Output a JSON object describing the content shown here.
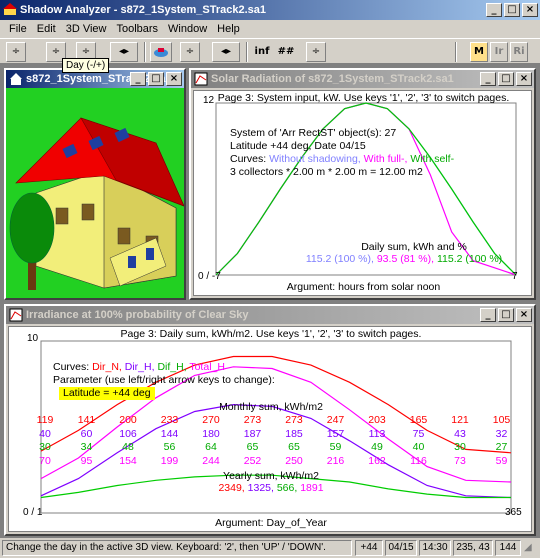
{
  "app": {
    "title": "Shadow Analyzer - s872_1System_STrack2.sa1"
  },
  "menu": [
    "File",
    "Edit",
    "3D View",
    "Toolbars",
    "Window",
    "Help"
  ],
  "toolbar": {
    "inf_label": "inf",
    "hash_label": "##",
    "m_label": "M",
    "ir_label": "Ir",
    "ri_label": "Ri"
  },
  "tooltip": "Day (-/+)",
  "view3d": {
    "title": "s872_1System_STrack2.sa1"
  },
  "solar": {
    "title": "Solar Radiation of s872_1System_STrack2.sa1",
    "header": "Page 3: System input, kW. Use keys '1', '2', '3' to switch pages.",
    "line1": "System of 'Arr RectST' object(s): 27",
    "line2": "Latitude +44 deg, Date 04/15",
    "curves_label": "Curves: ",
    "curve_without": "Without shadowing, ",
    "curve_full": "With full-, ",
    "curve_self": "With self-",
    "line4": "3 collectors * 2.00 m * 2.00 m = 12.00 m2",
    "daily_title": "Daily sum, kWh and %",
    "daily_a": "115.2 (100 %), ",
    "daily_b": "93.5 (81 %), ",
    "daily_c": "115.2 (100 %)",
    "y_top": "12",
    "x_left": "0 / -7",
    "x_right": "7",
    "xlabel": "Argument: hours from solar noon",
    "colors": {
      "without": "#8080ff",
      "full": "#ff00ff",
      "self": "#00cc00"
    },
    "chart_data": {
      "type": "line",
      "x": [
        -7,
        -6,
        -5,
        -4,
        -3,
        -2,
        -1,
        0,
        1,
        2,
        3,
        4,
        5,
        6,
        7
      ],
      "ylim": [
        0,
        12
      ],
      "series": [
        {
          "name": "Without shadowing",
          "values": [
            0,
            1.5,
            3.7,
            6.0,
            8.2,
            10.2,
            11.6,
            12,
            11.6,
            10.2,
            8.2,
            6.0,
            3.7,
            1.5,
            0
          ]
        },
        {
          "name": "With full-",
          "values": [
            0,
            1.5,
            3.7,
            6.0,
            8.2,
            10.2,
            11.6,
            12,
            11.6,
            10.2,
            7.0,
            3.0,
            1.0,
            0.5,
            0
          ]
        },
        {
          "name": "With self-",
          "values": [
            0,
            1.5,
            3.7,
            6.0,
            8.2,
            10.2,
            11.6,
            12,
            11.6,
            10.2,
            8.2,
            6.0,
            3.7,
            1.5,
            0
          ]
        }
      ]
    }
  },
  "irr": {
    "title": "Irradiance at 100% probability of Clear Sky",
    "header": "Page 3: Daily sum, kWh/m2. Use keys '1', '2', '3' to switch pages.",
    "curves_label": "Curves: ",
    "c_dirn": "Dir_N, ",
    "c_dirh": "Dir_H, ",
    "c_difh": "Dif_H, ",
    "c_total": "Total_H",
    "param": "Parameter (use left/right arrow keys to change):",
    "latitude": "Latitude = +44 deg",
    "monthly_title": "Monthly sum, kWh/m2",
    "months": {
      "dirn": [
        "119",
        "141",
        "200",
        "233",
        "270",
        "273",
        "273",
        "247",
        "203",
        "165",
        "121",
        "105"
      ],
      "dirh": [
        "40",
        "60",
        "106",
        "144",
        "180",
        "187",
        "185",
        "157",
        "113",
        "75",
        "43",
        "32"
      ],
      "difh": [
        "30",
        "34",
        "48",
        "56",
        "64",
        "65",
        "65",
        "59",
        "49",
        "40",
        "30",
        "27"
      ],
      "total": [
        "70",
        "95",
        "154",
        "199",
        "244",
        "252",
        "250",
        "216",
        "162",
        "116",
        "73",
        "59"
      ]
    },
    "yearly_title": "Yearly sum, kWh/m2",
    "y_dirn": "2349, ",
    "y_dirh": "1325, ",
    "y_difh": "566, ",
    "y_total": "1891",
    "y_top": "10",
    "x_left": "0 / 1",
    "x_right": "365",
    "xlabel": "Argument: Day_of_Year",
    "colors": {
      "dirn": "#ff0000",
      "dirh": "#8000ff",
      "difh": "#00cc00",
      "total": "#ff00ff"
    },
    "chart_data": {
      "type": "line",
      "x": [
        1,
        30,
        60,
        90,
        120,
        150,
        180,
        210,
        240,
        270,
        300,
        330,
        365
      ],
      "ylim": [
        0,
        10
      ],
      "series": [
        {
          "name": "Dir_N",
          "values": [
            3.6,
            4.8,
            6.3,
            7.6,
            8.6,
            9.1,
            9.1,
            8.6,
            7.6,
            6.3,
            4.8,
            3.7,
            3.5
          ]
        },
        {
          "name": "Dir_H",
          "values": [
            1.0,
            2.0,
            3.5,
            4.9,
            5.9,
            6.3,
            6.2,
            5.5,
            4.2,
            2.8,
            1.6,
            1.0,
            0.9
          ]
        },
        {
          "name": "Dif_H",
          "values": [
            0.9,
            1.2,
            1.6,
            1.9,
            2.1,
            2.2,
            2.2,
            2.0,
            1.8,
            1.4,
            1.1,
            0.9,
            0.9
          ]
        },
        {
          "name": "Total_H",
          "values": [
            2.0,
            3.2,
            5.0,
            6.7,
            8.0,
            8.5,
            8.4,
            7.6,
            6.0,
            4.3,
            2.7,
            1.9,
            1.8
          ]
        }
      ]
    }
  },
  "status": {
    "message": "Change the day in the active 3D view. Keyboard: '2', then 'UP' / 'DOWN'.",
    "lat": "+44",
    "date": "04/15",
    "time": "14:30",
    "az": "235, 43",
    "num": "144"
  }
}
